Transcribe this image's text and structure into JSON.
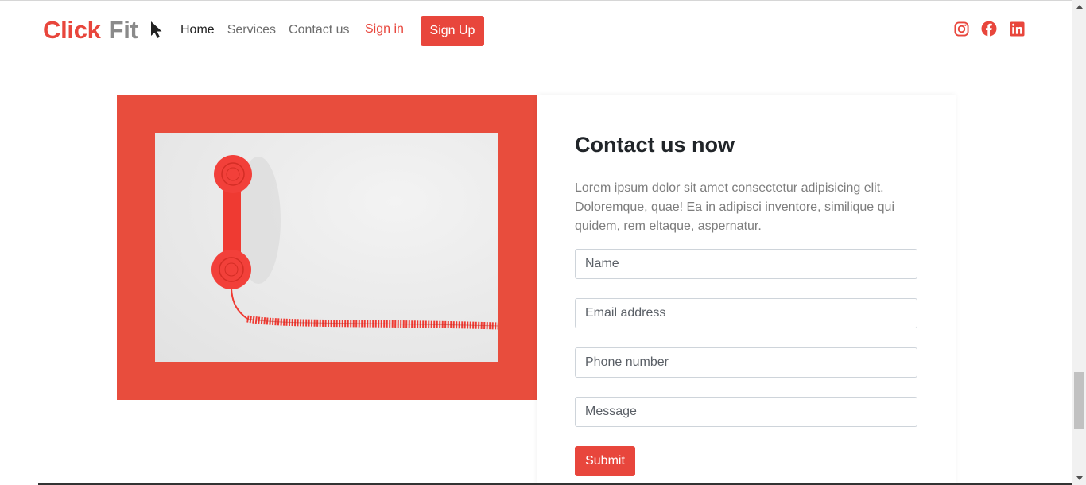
{
  "brand": {
    "part1": "Click",
    "part2": "Fit"
  },
  "nav": {
    "links": [
      {
        "label": "Home",
        "active": true
      },
      {
        "label": "Services",
        "active": false
      },
      {
        "label": "Contact us",
        "active": false
      }
    ],
    "signin": "Sign in",
    "signup": "Sign Up"
  },
  "socials": [
    "instagram-icon",
    "facebook-icon",
    "linkedin-icon"
  ],
  "contact": {
    "title": "Contact us now",
    "text": "Lorem ipsum dolor sit amet consectetur adipisicing elit. Doloremque, quae! Ea in adipisci inventore, similique qui quidem, rem eltaque, aspernatur.",
    "fields": {
      "name": "Name",
      "email": "Email address",
      "phone": "Phone number",
      "message": "Message"
    },
    "submit": "Submit"
  },
  "colors": {
    "accent": "#e8463c",
    "panel": "#e84d3d"
  }
}
